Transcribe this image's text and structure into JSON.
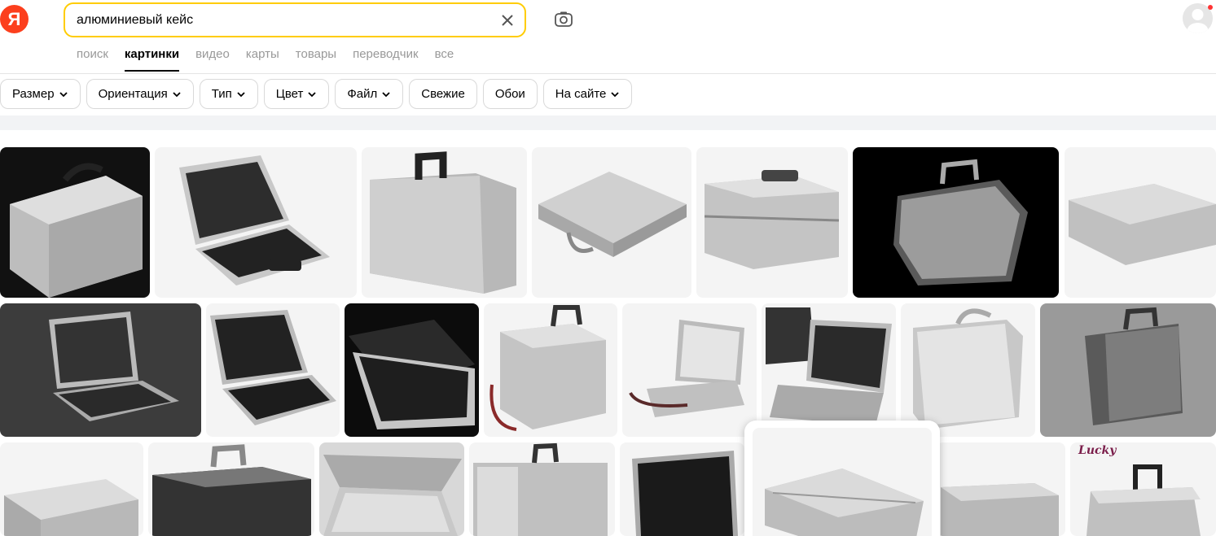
{
  "logo": {
    "text": "Я",
    "color": "#fc3f1d"
  },
  "search": {
    "value": "алюминиевый кейс",
    "clear_icon": "close-icon",
    "camera_icon": "camera-icon"
  },
  "tabs": [
    {
      "label": "поиск",
      "active": false
    },
    {
      "label": "картинки",
      "active": true
    },
    {
      "label": "видео",
      "active": false
    },
    {
      "label": "карты",
      "active": false
    },
    {
      "label": "товары",
      "active": false
    },
    {
      "label": "переводчик",
      "active": false
    },
    {
      "label": "все",
      "active": false
    }
  ],
  "filters": [
    {
      "label": "Размер",
      "dropdown": true
    },
    {
      "label": "Ориентация",
      "dropdown": true
    },
    {
      "label": "Тип",
      "dropdown": true
    },
    {
      "label": "Цвет",
      "dropdown": true
    },
    {
      "label": "Файл",
      "dropdown": true
    },
    {
      "label": "Свежие",
      "dropdown": false
    },
    {
      "label": "Обои",
      "dropdown": false
    },
    {
      "label": "На сайте",
      "dropdown": true
    }
  ],
  "results": {
    "row1": [
      {
        "name": "silver-case-dark",
        "bg": "#111111"
      },
      {
        "name": "open-tool-case",
        "bg": "#f4f4f4"
      },
      {
        "name": "silver-case-handle",
        "bg": "#f4f4f4"
      },
      {
        "name": "flat-silver-case",
        "bg": "#f4f4f4"
      },
      {
        "name": "cosmetic-case",
        "bg": "#f4f4f4"
      },
      {
        "name": "chrome-briefcase",
        "bg": "#000000"
      },
      {
        "name": "silver-case-side",
        "bg": "#f4f4f4"
      }
    ],
    "row2": [
      {
        "name": "open-foam-case-gray",
        "bg": "#3c3c3c"
      },
      {
        "name": "open-tool-organizer",
        "bg": "#f4f4f4"
      },
      {
        "name": "open-foam-case-black",
        "bg": "#0c0c0c"
      },
      {
        "name": "cosmetic-case-strap",
        "bg": "#f4f4f4"
      },
      {
        "name": "open-case-strap",
        "bg": "#f4f4f4"
      },
      {
        "name": "tool-set-case",
        "bg": "#f4f4f4"
      },
      {
        "name": "silver-attache-case",
        "bg": "#f4f4f4"
      },
      {
        "name": "vertical-silver-case",
        "bg": "#9a9a9a"
      }
    ],
    "row3": [
      {
        "name": "closed-silver-case",
        "bg": "#f4f4f4"
      },
      {
        "name": "black-cosmetic-case",
        "bg": "#f4f4f4"
      },
      {
        "name": "open-metal-box",
        "bg": "#d8d8d8"
      },
      {
        "name": "tall-silver-case",
        "bg": "#f4f4f4"
      },
      {
        "name": "open-black-case",
        "bg": "#f4f4f4"
      },
      {
        "name": "silver-case-handle-2",
        "bg": "#f4f4f4"
      },
      {
        "name": "trolley-case",
        "bg": "#f4f4f4",
        "watermark": "Lucky"
      }
    ]
  }
}
